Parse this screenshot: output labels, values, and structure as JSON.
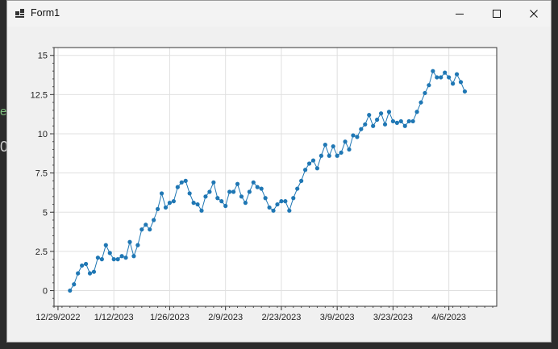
{
  "background_edge": {
    "line1": "e",
    "line2": "0"
  },
  "window": {
    "title": "Form1",
    "app_icon": "windows-form-icon",
    "controls": {
      "minimize_icon": "minimize-icon",
      "maximize_icon": "maximize-icon",
      "close_icon": "close-icon"
    }
  },
  "colors": {
    "series": "#1f77b4",
    "grid": "#e0e0e0",
    "window_bg": "#f0f0f0"
  },
  "chart_data": {
    "type": "scatter",
    "title": "",
    "xlabel": "",
    "ylabel": "",
    "x_axis_type": "date",
    "xlim": [
      "2022-12-28",
      "2023-04-18"
    ],
    "ylim": [
      -1.0,
      15.5
    ],
    "x_ticks": [
      "12/29/2022",
      "1/12/2023",
      "1/26/2023",
      "2/9/2023",
      "2/23/2023",
      "3/9/2023",
      "3/23/2023",
      "4/6/2023"
    ],
    "y_ticks": [
      "0",
      "2.5",
      "5",
      "7.5",
      "10",
      "12.5",
      "15"
    ],
    "grid": true,
    "legend": "none",
    "series": [
      {
        "marker": "circle",
        "line": true,
        "x": [
          "2023-01-01",
          "2023-01-02",
          "2023-01-03",
          "2023-01-04",
          "2023-01-05",
          "2023-01-06",
          "2023-01-07",
          "2023-01-08",
          "2023-01-09",
          "2023-01-10",
          "2023-01-11",
          "2023-01-12",
          "2023-01-13",
          "2023-01-14",
          "2023-01-15",
          "2023-01-16",
          "2023-01-17",
          "2023-01-18",
          "2023-01-19",
          "2023-01-20",
          "2023-01-21",
          "2023-01-22",
          "2023-01-23",
          "2023-01-24",
          "2023-01-25",
          "2023-01-26",
          "2023-01-27",
          "2023-01-28",
          "2023-01-29",
          "2023-01-30",
          "2023-01-31",
          "2023-02-01",
          "2023-02-02",
          "2023-02-03",
          "2023-02-04",
          "2023-02-05",
          "2023-02-06",
          "2023-02-07",
          "2023-02-08",
          "2023-02-09",
          "2023-02-10",
          "2023-02-11",
          "2023-02-12",
          "2023-02-13",
          "2023-02-14",
          "2023-02-15",
          "2023-02-16",
          "2023-02-17",
          "2023-02-18",
          "2023-02-19",
          "2023-02-20",
          "2023-02-21",
          "2023-02-22",
          "2023-02-23",
          "2023-02-24",
          "2023-02-25",
          "2023-02-26",
          "2023-02-27",
          "2023-02-28",
          "2023-03-01",
          "2023-03-02",
          "2023-03-03",
          "2023-03-04",
          "2023-03-05",
          "2023-03-06",
          "2023-03-07",
          "2023-03-08",
          "2023-03-09",
          "2023-03-10",
          "2023-03-11",
          "2023-03-12",
          "2023-03-13",
          "2023-03-14",
          "2023-03-15",
          "2023-03-16",
          "2023-03-17",
          "2023-03-18",
          "2023-03-19",
          "2023-03-20",
          "2023-03-21",
          "2023-03-22",
          "2023-03-23",
          "2023-03-24",
          "2023-03-25",
          "2023-03-26",
          "2023-03-27",
          "2023-03-28",
          "2023-03-29",
          "2023-03-30",
          "2023-03-31",
          "2023-04-01",
          "2023-04-02",
          "2023-04-03",
          "2023-04-04",
          "2023-04-05",
          "2023-04-06",
          "2023-04-07",
          "2023-04-08",
          "2023-04-09",
          "2023-04-10"
        ],
        "y": [
          0.0,
          0.4,
          1.1,
          1.6,
          1.7,
          1.1,
          1.2,
          2.1,
          2.0,
          2.9,
          2.4,
          2.0,
          2.0,
          2.2,
          2.1,
          3.1,
          2.2,
          2.9,
          3.9,
          4.2,
          3.9,
          4.5,
          5.2,
          6.2,
          5.3,
          5.6,
          5.7,
          6.6,
          6.9,
          7.0,
          6.2,
          5.6,
          5.5,
          5.1,
          6.0,
          6.3,
          6.9,
          5.9,
          5.7,
          5.4,
          6.3,
          6.3,
          6.8,
          6.0,
          5.6,
          6.3,
          6.9,
          6.6,
          6.5,
          5.9,
          5.3,
          5.1,
          5.5,
          5.7,
          5.7,
          5.1,
          5.9,
          6.5,
          7.0,
          7.7,
          8.1,
          8.3,
          7.8,
          8.6,
          9.3,
          8.6,
          9.2,
          8.6,
          8.8,
          9.5,
          9.0,
          9.9,
          9.8,
          10.3,
          10.6,
          11.2,
          10.5,
          10.9,
          11.3,
          10.6,
          11.4,
          10.8,
          10.7,
          10.8,
          10.5,
          10.8,
          10.8,
          11.4,
          12.0,
          12.6,
          13.1,
          14.0,
          13.6,
          13.6,
          13.9,
          13.6,
          13.2,
          13.8,
          13.3,
          12.7
        ]
      }
    ]
  }
}
